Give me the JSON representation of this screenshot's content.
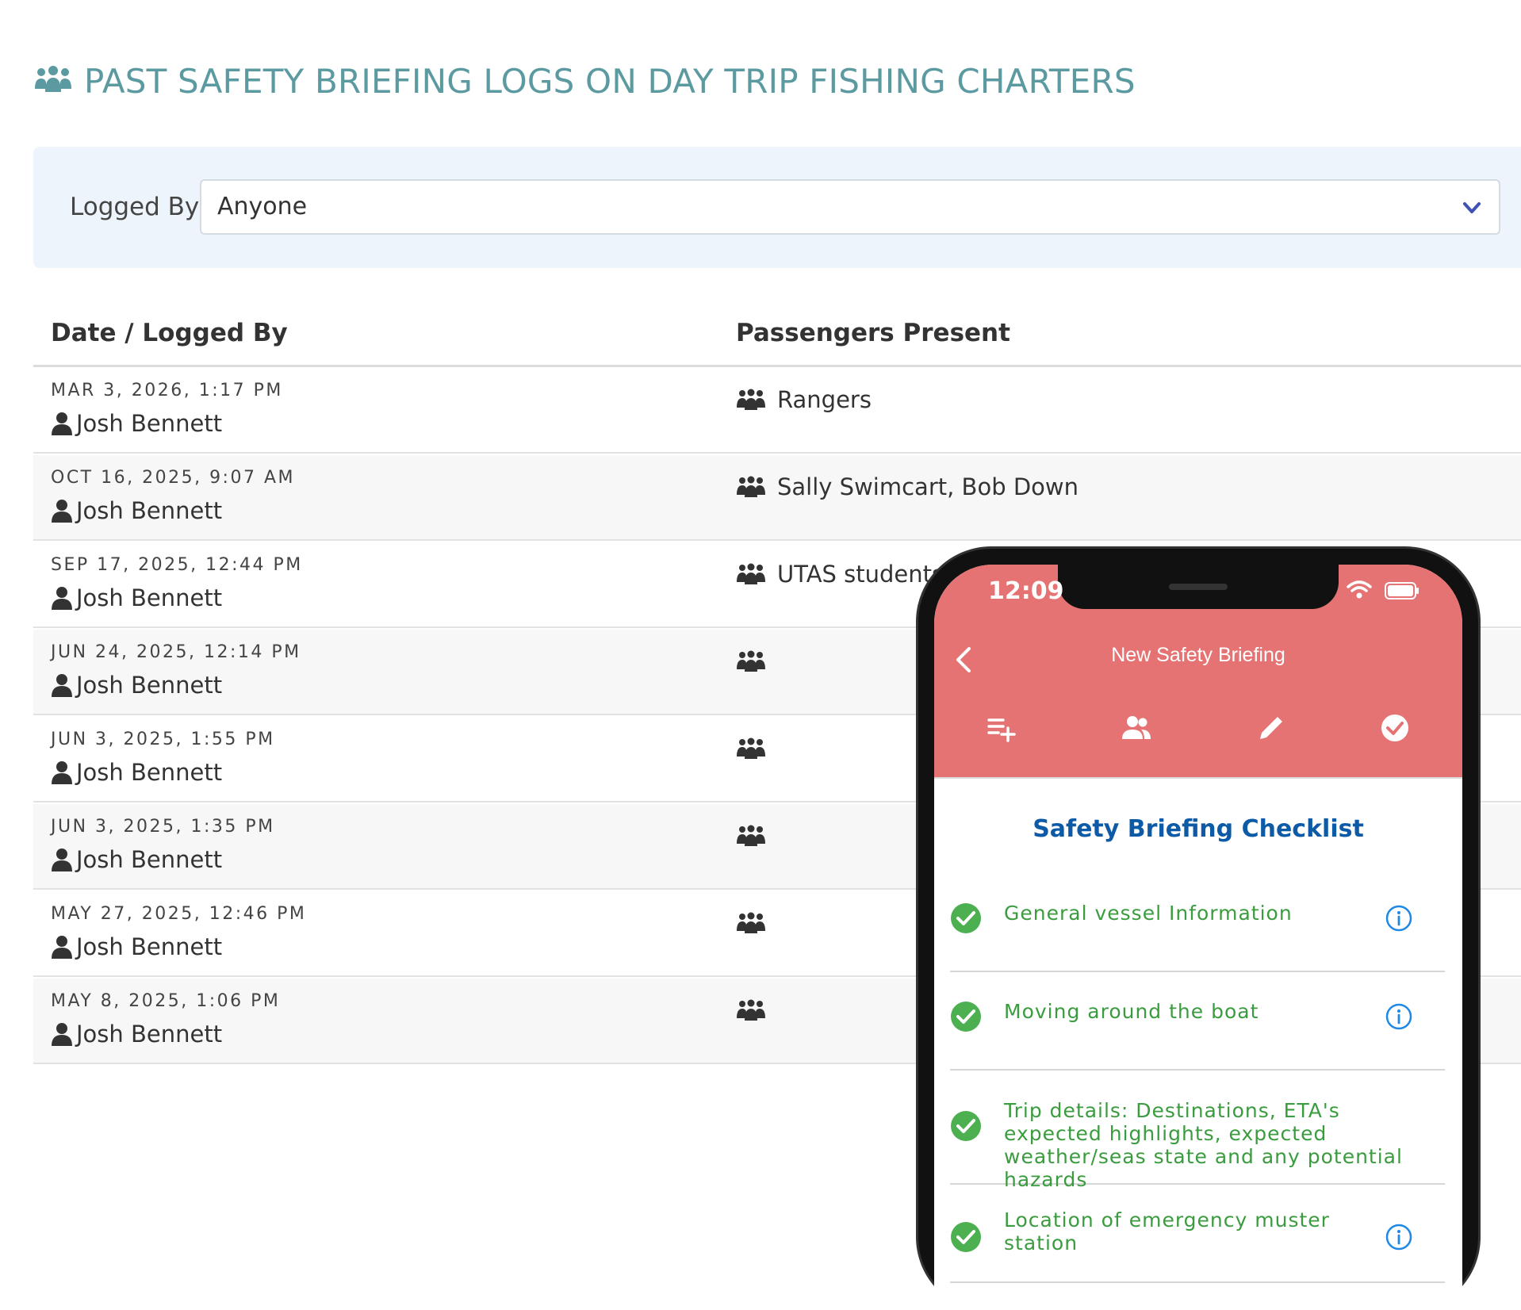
{
  "page": {
    "title": "PAST SAFETY BRIEFING LOGS ON DAY TRIP FISHING CHARTERS",
    "title_icon": "group-icon",
    "colors": {
      "title": "#5b9aa0",
      "filter_bg": "#eef4fb",
      "phone_header": "#e57373",
      "check_green": "#3a9c3e",
      "checklist_title": "#0d5aa7"
    }
  },
  "filter": {
    "label": "Logged By:",
    "selected": "Anyone",
    "icon": "chevron-down-icon"
  },
  "table": {
    "headers": [
      "Date / Logged By",
      "Passengers Present"
    ],
    "rows": [
      {
        "date": "MAR 3, 2026, 1:17 PM",
        "logged_by": "Josh Bennett",
        "passengers": "Rangers"
      },
      {
        "date": "OCT 16, 2025, 9:07 AM",
        "logged_by": "Josh Bennett",
        "passengers": "Sally Swimcart, Bob Down"
      },
      {
        "date": "SEP 17, 2025, 12:44 PM",
        "logged_by": "Josh Bennett",
        "passengers": "UTAS students"
      },
      {
        "date": "JUN 24, 2025, 12:14 PM",
        "logged_by": "Josh Bennett",
        "passengers": ""
      },
      {
        "date": "JUN 3, 2025, 1:55 PM",
        "logged_by": "Josh Bennett",
        "passengers": ""
      },
      {
        "date": "JUN 3, 2025, 1:35 PM",
        "logged_by": "Josh Bennett",
        "passengers": ""
      },
      {
        "date": "MAY 27, 2025, 12:46 PM",
        "logged_by": "Josh Bennett",
        "passengers": ""
      },
      {
        "date": "MAY 8, 2025, 1:06 PM",
        "logged_by": "Josh Bennett",
        "passengers": ""
      }
    ]
  },
  "phone": {
    "time": "12:09",
    "nav_title": "New Safety Briefing",
    "steps": [
      "list-add-icon",
      "people-icon",
      "pencil-icon",
      "check-circle-icon"
    ],
    "checklist_title": "Safety Briefing Checklist",
    "items": [
      {
        "text": "General vessel Information",
        "has_info": true
      },
      {
        "text": "Moving around the boat",
        "has_info": true
      },
      {
        "text": "Trip details: Destinations, ETA's expected highlights, expected weather/seas state and any potential hazards",
        "has_info": false
      },
      {
        "text": "Location of emergency muster station",
        "has_info": true
      }
    ]
  }
}
